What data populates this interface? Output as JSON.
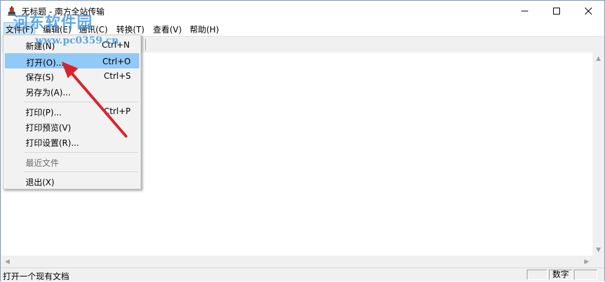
{
  "window": {
    "title": "无标题 - 南方全站传输"
  },
  "menubar": {
    "items": [
      {
        "label": "文件(F)"
      },
      {
        "label": "编辑(E)"
      },
      {
        "label": "通讯(C)"
      },
      {
        "label": "转换(T)"
      },
      {
        "label": "查看(V)"
      },
      {
        "label": "帮助(H)"
      }
    ]
  },
  "file_menu": {
    "items": [
      {
        "label": "新建(N)",
        "shortcut": "Ctrl+N"
      },
      {
        "label": "打开(O)...",
        "shortcut": "Ctrl+O"
      },
      {
        "label": "保存(S)",
        "shortcut": "Ctrl+S"
      },
      {
        "label": "另存为(A)...",
        "shortcut": ""
      },
      {
        "label": "打印(P)...",
        "shortcut": "Ctrl+P"
      },
      {
        "label": "打印预览(V)",
        "shortcut": ""
      },
      {
        "label": "打印设置(R)...",
        "shortcut": ""
      },
      {
        "label": "最近文件",
        "shortcut": ""
      },
      {
        "label": "退出(X)",
        "shortcut": ""
      }
    ]
  },
  "statusbar": {
    "text": "打开一个现有文档",
    "pane_numlock": "数字"
  },
  "watermark": {
    "text": "河东软件园",
    "url": "www.pc0359.cn"
  },
  "colors": {
    "highlight": "#91c9f7",
    "arrow": "#d9232a",
    "watermark": "#2a8cdc"
  },
  "icons": {
    "app": "app-icon",
    "minimize": "minimize-icon",
    "maximize": "maximize-icon",
    "close": "close-icon"
  }
}
